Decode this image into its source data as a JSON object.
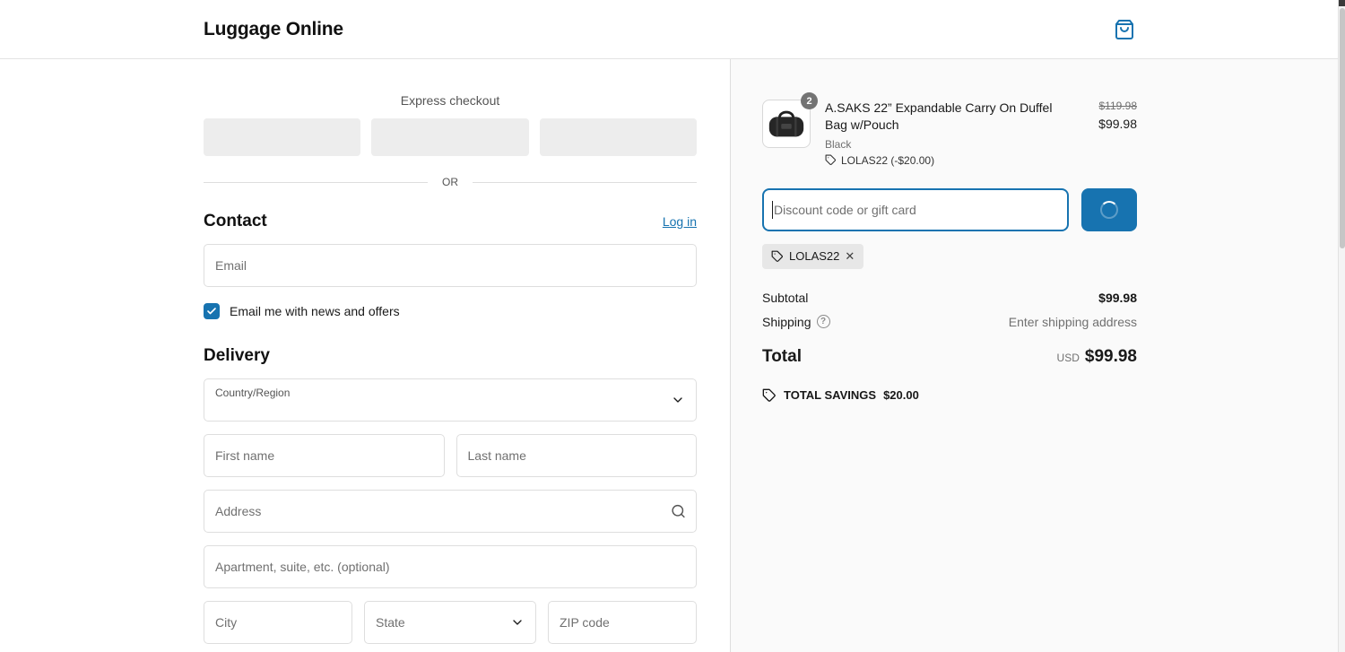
{
  "header": {
    "store_name": "Luggage Online"
  },
  "express": {
    "title": "Express checkout",
    "or": "OR"
  },
  "contact": {
    "heading": "Contact",
    "login_label": "Log in",
    "email_placeholder": "Email",
    "newsletter_label": "Email me with news and offers"
  },
  "delivery": {
    "heading": "Delivery",
    "country_label": "Country/Region",
    "first_name_placeholder": "First name",
    "last_name_placeholder": "Last name",
    "address_placeholder": "Address",
    "apartment_placeholder": "Apartment, suite, etc. (optional)",
    "city_placeholder": "City",
    "state_label": "State",
    "zip_placeholder": "ZIP code"
  },
  "summary": {
    "item": {
      "quantity": "2",
      "title": "A.SAKS 22” Expandable Carry On Duffel Bag w/Pouch",
      "variant": "Black",
      "discount_tag": "LOLAS22 (-$20.00)",
      "original_price": "$119.98",
      "price": "$99.98"
    },
    "discount": {
      "placeholder": "Discount code or gift card",
      "applied_code": "LOLAS22",
      "remove_label": "✕"
    },
    "totals": {
      "subtotal_label": "Subtotal",
      "subtotal_value": "$99.98",
      "shipping_label": "Shipping",
      "shipping_help": "?",
      "shipping_value": "Enter shipping address",
      "total_label": "Total",
      "currency": "USD",
      "total_value": "$99.98",
      "savings_label": "TOTAL SAVINGS",
      "savings_value": "$20.00"
    }
  },
  "colors": {
    "accent": "#1773b0",
    "panel_bg": "#fafafa",
    "border": "#dedede",
    "muted_text": "#707070"
  }
}
